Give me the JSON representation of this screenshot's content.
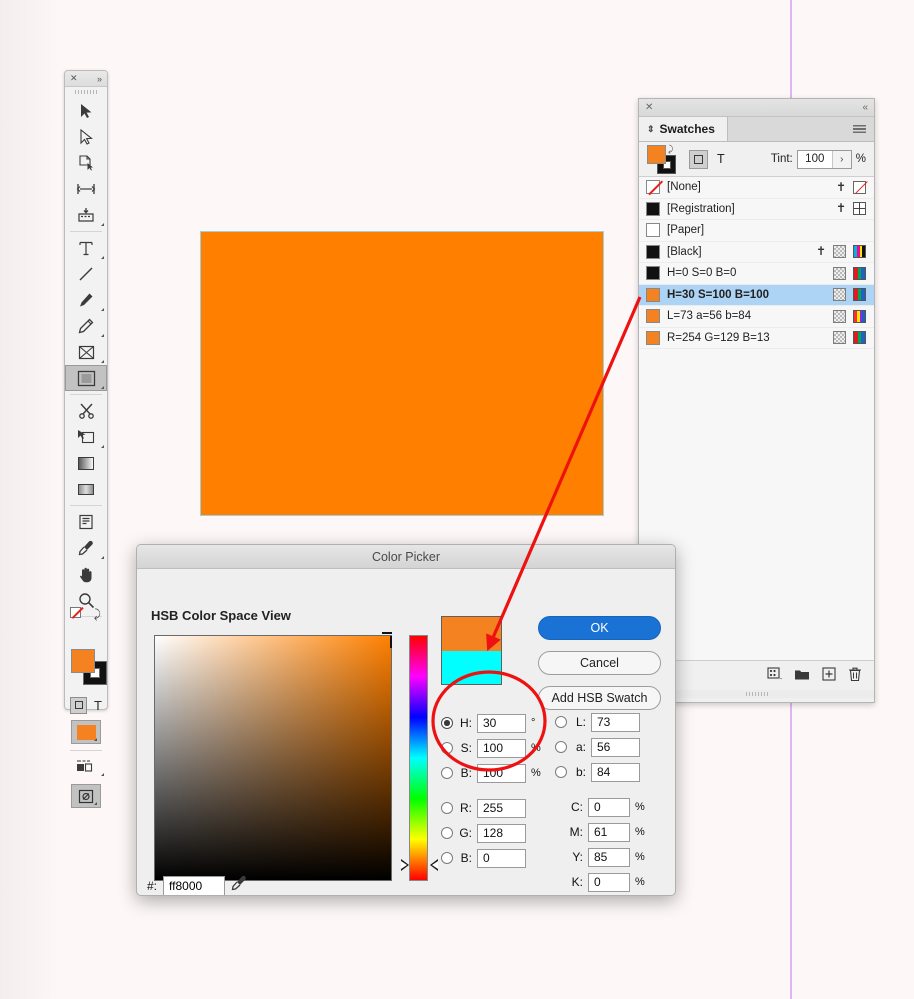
{
  "app": {
    "canvas_bg": "#fdf8f7",
    "guide_color": "#d79ef0",
    "rect_fill": "#ff8000",
    "selection_border": "#9fd0dd",
    "accent_blue": "#1a73d4",
    "annotation_color": "#ee1111"
  },
  "toolbar": {
    "close_glyph": "✕",
    "expand_glyph": "»",
    "tools": [
      {
        "name": "selection-tool",
        "glyph": "selection",
        "selected": false
      },
      {
        "name": "direct-selection-tool",
        "glyph": "direct-selection",
        "selected": false
      },
      {
        "name": "page-tool",
        "glyph": "page",
        "selected": false
      },
      {
        "name": "gap-tool",
        "glyph": "gap",
        "selected": false
      },
      {
        "name": "content-collector-tool",
        "glyph": "content-collector",
        "selected": false
      },
      {
        "name": "type-tool",
        "glyph": "T",
        "selected": false
      },
      {
        "name": "line-tool",
        "glyph": "line",
        "selected": false
      },
      {
        "name": "pen-tool",
        "glyph": "pen",
        "selected": false
      },
      {
        "name": "pencil-tool",
        "glyph": "pencil",
        "selected": false
      },
      {
        "name": "frame-tool",
        "glyph": "frame",
        "selected": false
      },
      {
        "name": "rectangle-tool",
        "glyph": "rectangle",
        "selected": true
      },
      {
        "name": "scissors-tool",
        "glyph": "scissors",
        "selected": false
      },
      {
        "name": "free-transform-tool",
        "glyph": "free-transform",
        "selected": false
      },
      {
        "name": "gradient-swatch-tool",
        "glyph": "gradient",
        "selected": false
      },
      {
        "name": "gradient-feather-tool",
        "glyph": "gradient-feather",
        "selected": false
      },
      {
        "name": "note-tool",
        "glyph": "note",
        "selected": false
      },
      {
        "name": "eyedropper-tool",
        "glyph": "eyedropper",
        "selected": false
      },
      {
        "name": "hand-tool",
        "glyph": "hand",
        "selected": false
      },
      {
        "name": "zoom-tool",
        "glyph": "zoom",
        "selected": false
      }
    ],
    "fill_color": "#f58220",
    "stroke_color": "#111111",
    "swap_glyph": "⤸",
    "formatting_label": "T",
    "apply_color_fill": "#f58220"
  },
  "swatches_panel": {
    "close_glyph": "✕",
    "collapse_glyph": "«",
    "tab_label": "Swatches",
    "tab_icon": "sort-arrows-icon",
    "menu_icon": "panel-menu-icon",
    "tint_label": "Tint:",
    "tint_value": "100",
    "tint_unit": "%",
    "tint_stepper_glyph": "›",
    "formatting_label": "T",
    "rows": [
      {
        "name": "[None]",
        "chip": "none",
        "chip_color": "#ffffff",
        "pin": true,
        "right_icon": "none-icon",
        "tile": false,
        "active": false
      },
      {
        "name": "[Registration]",
        "chip": "solid",
        "chip_color": "#111111",
        "pin": true,
        "right_icon": "registration-icon",
        "tile": false,
        "active": false
      },
      {
        "name": "[Paper]",
        "chip": "solid",
        "chip_color": "#ffffff",
        "pin": false,
        "right_icon": "",
        "tile": false,
        "active": false
      },
      {
        "name": "[Black]",
        "chip": "solid",
        "chip_color": "#111111",
        "pin": true,
        "right_icon": "cmyk-icon",
        "tile": true,
        "active": false
      },
      {
        "name": "H=0 S=0 B=0",
        "chip": "solid",
        "chip_color": "#111111",
        "pin": false,
        "right_icon": "rgb-icon",
        "tile": true,
        "active": false
      },
      {
        "name": "H=30 S=100 B=100",
        "chip": "solid",
        "chip_color": "#f58220",
        "pin": false,
        "right_icon": "rgb-icon",
        "tile": true,
        "active": true
      },
      {
        "name": "L=73 a=56 b=84",
        "chip": "solid",
        "chip_color": "#f58220",
        "pin": false,
        "right_icon": "lab-icon",
        "tile": true,
        "active": false
      },
      {
        "name": "R=254 G=129 B=13",
        "chip": "solid",
        "chip_color": "#f58220",
        "pin": false,
        "right_icon": "rgb-icon",
        "tile": true,
        "active": false
      }
    ],
    "footer_icons": [
      "show-swatch-groups-icon",
      "new-color-group-icon",
      "new-swatch-icon",
      "delete-swatch-icon"
    ]
  },
  "color_picker": {
    "title": "Color Picker",
    "heading": "HSB Color Space View",
    "buttons": {
      "ok": "OK",
      "cancel": "Cancel",
      "add_swatch": "Add HSB Swatch"
    },
    "preview_new": "#f58220",
    "preview_old": "#00ffff",
    "hsb": [
      {
        "label": "H:",
        "value": "30",
        "unit": "°",
        "selected": true
      },
      {
        "label": "S:",
        "value": "100",
        "unit": "%",
        "selected": false
      },
      {
        "label": "B:",
        "value": "100",
        "unit": "%",
        "selected": false
      }
    ],
    "lab": [
      {
        "label": "L:",
        "value": "73",
        "unit": "",
        "selected": false
      },
      {
        "label": "a:",
        "value": "56",
        "unit": "",
        "selected": false
      },
      {
        "label": "b:",
        "value": "84",
        "unit": "",
        "selected": false
      }
    ],
    "rgb": [
      {
        "label": "R:",
        "value": "255",
        "unit": "",
        "selected": false
      },
      {
        "label": "G:",
        "value": "128",
        "unit": "",
        "selected": false
      },
      {
        "label": "B:",
        "value": "0",
        "unit": "",
        "selected": false
      }
    ],
    "cmyk": [
      {
        "label": "C:",
        "value": "0",
        "unit": "%"
      },
      {
        "label": "M:",
        "value": "61",
        "unit": "%"
      },
      {
        "label": "Y:",
        "value": "85",
        "unit": "%"
      },
      {
        "label": "K:",
        "value": "0",
        "unit": "%"
      }
    ],
    "hex_label": "#:",
    "hex_value": "ff8000",
    "eyedropper_icon": "eyedropper-icon"
  }
}
